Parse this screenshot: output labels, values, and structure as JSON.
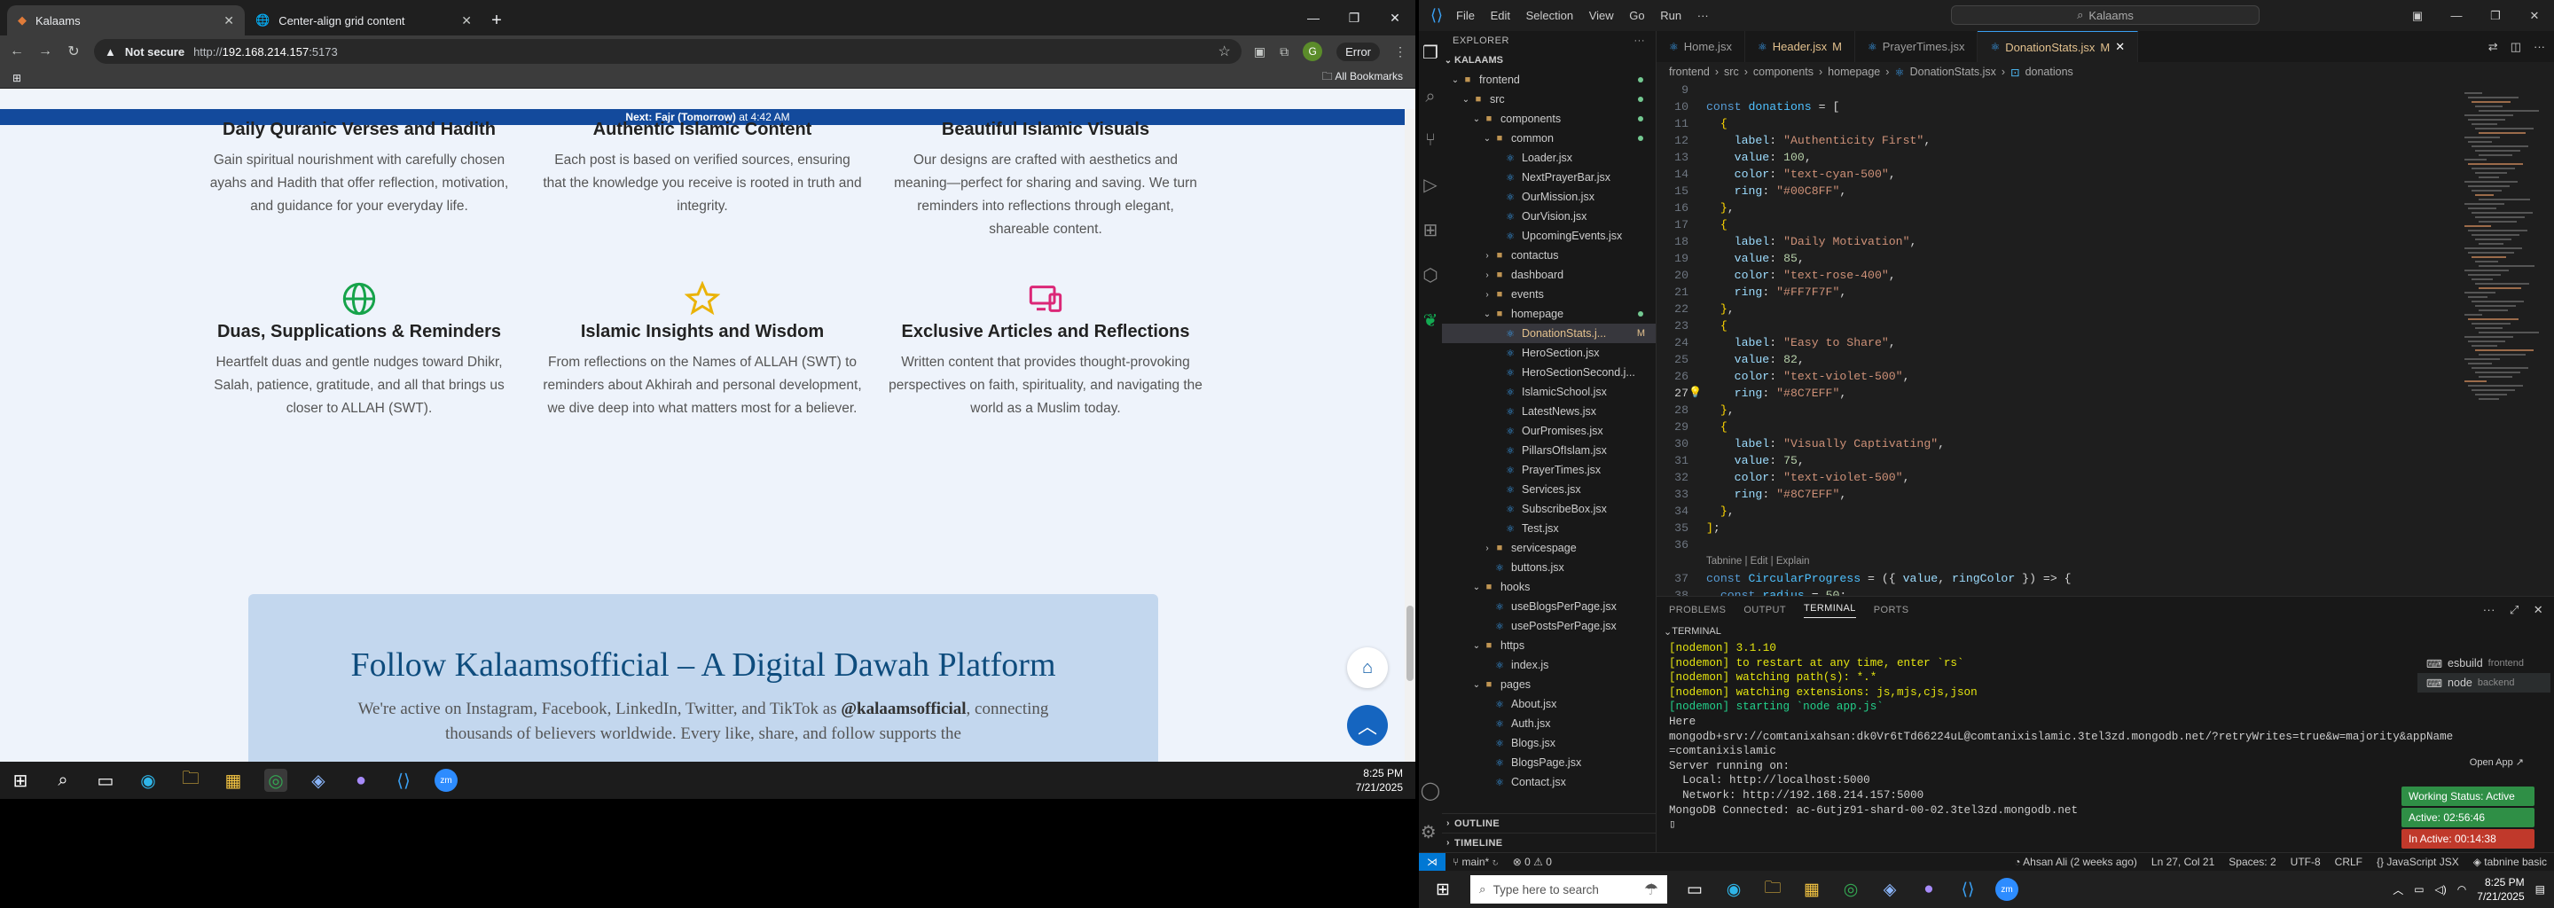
{
  "chrome": {
    "tabs": [
      {
        "title": "Kalaams",
        "icon": "kalaams-favicon",
        "active": true
      },
      {
        "title": "Center-align grid content",
        "icon": "globe-icon",
        "active": false
      }
    ],
    "address": {
      "not_secure": "Not secure",
      "url_prefix": "http://",
      "host": "192.168.214.157",
      "port": ":5173"
    },
    "profile_initial": "G",
    "error_label": "Error",
    "bookmarks_label": "All Bookmarks",
    "notice": {
      "label": "Next: Fajr (Tomorrow)",
      "time": "at 4:42 AM"
    },
    "features_top": [
      {
        "title": "Daily Quranic Verses and Hadith",
        "desc": "Gain spiritual nourishment with carefully chosen ayahs and Hadith that offer reflection, motivation, and guidance for your everyday life."
      },
      {
        "title": "Authentic Islamic Content",
        "desc": "Each post is based on verified sources, ensuring that the knowledge you receive is rooted in truth and integrity."
      },
      {
        "title": "Beautiful Islamic Visuals",
        "desc": "Our designs are crafted with aesthetics and meaning—perfect for sharing and saving. We turn reminders into reflections through elegant, shareable content."
      }
    ],
    "features_bottom": [
      {
        "title": "Duas, Supplications & Reminders",
        "desc": "Heartfelt duas and gentle nudges toward Dhikr, Salah, patience, gratitude, and all that brings us closer to ALLAH (SWT).",
        "icon": "globe-icon",
        "color": "#16a34a"
      },
      {
        "title": "Islamic Insights and Wisdom",
        "desc": "From reflections on the Names of ALLAH (SWT) to reminders about Akhirah and personal development, we dive deep into what matters most for a believer.",
        "icon": "star-icon",
        "color": "#eab308"
      },
      {
        "title": "Exclusive Articles and Reflections",
        "desc": "Written content that provides thought-provoking perspectives on faith, spirituality, and navigating the world as a Muslim today.",
        "icon": "devices-icon",
        "color": "#db2777"
      }
    ],
    "follow": {
      "title": "Follow Kalaamsofficial – A Digital Dawah Platform",
      "text_before": "We're active on Instagram, Facebook, LinkedIn, Twitter, and TikTok as ",
      "handle": "@kalaamsofficial",
      "text_after": ", connecting thousands of believers worldwide. Every like, share, and follow supports the"
    },
    "taskbar_clock": {
      "time": "8:25 PM",
      "date": "7/21/2025"
    }
  },
  "vscode": {
    "menu": [
      "File",
      "Edit",
      "Selection",
      "View",
      "Go",
      "Run",
      "···"
    ],
    "search": "Kalaams",
    "explorer_title": "EXPLORER",
    "root": "KALAAMS",
    "tree": [
      {
        "label": "frontend",
        "type": "folder",
        "depth": 0,
        "open": true,
        "dot": true
      },
      {
        "label": "src",
        "type": "folder",
        "depth": 1,
        "open": true,
        "dot": true
      },
      {
        "label": "components",
        "type": "folder",
        "depth": 2,
        "open": true,
        "dot": true
      },
      {
        "label": "common",
        "type": "folder",
        "depth": 3,
        "open": true,
        "dot": true
      },
      {
        "label": "Loader.jsx",
        "type": "jsx",
        "depth": 4
      },
      {
        "label": "NextPrayerBar.jsx",
        "type": "jsx",
        "depth": 4
      },
      {
        "label": "OurMission.jsx",
        "type": "jsx",
        "depth": 4
      },
      {
        "label": "OurVision.jsx",
        "type": "jsx",
        "depth": 4
      },
      {
        "label": "UpcomingEvents.jsx",
        "type": "jsx",
        "depth": 4
      },
      {
        "label": "contactus",
        "type": "folder",
        "depth": 3,
        "open": false
      },
      {
        "label": "dashboard",
        "type": "folder",
        "depth": 3,
        "open": false
      },
      {
        "label": "events",
        "type": "folder",
        "depth": 3,
        "open": false
      },
      {
        "label": "homepage",
        "type": "folder",
        "depth": 3,
        "open": true,
        "dot": true
      },
      {
        "label": "DonationStats.j...",
        "type": "jsx",
        "depth": 4,
        "selected": true,
        "badge": "M"
      },
      {
        "label": "HeroSection.jsx",
        "type": "jsx",
        "depth": 4
      },
      {
        "label": "HeroSectionSecond.j...",
        "type": "jsx",
        "depth": 4
      },
      {
        "label": "IslamicSchool.jsx",
        "type": "jsx",
        "depth": 4
      },
      {
        "label": "LatestNews.jsx",
        "type": "jsx",
        "depth": 4
      },
      {
        "label": "OurPromises.jsx",
        "type": "jsx",
        "depth": 4
      },
      {
        "label": "PillarsOfIslam.jsx",
        "type": "jsx",
        "depth": 4
      },
      {
        "label": "PrayerTimes.jsx",
        "type": "jsx",
        "depth": 4
      },
      {
        "label": "Services.jsx",
        "type": "jsx",
        "depth": 4
      },
      {
        "label": "SubscribeBox.jsx",
        "type": "jsx",
        "depth": 4
      },
      {
        "label": "Test.jsx",
        "type": "jsx",
        "depth": 4
      },
      {
        "label": "servicespage",
        "type": "folder",
        "depth": 3,
        "open": false
      },
      {
        "label": "buttons.jsx",
        "type": "jsx",
        "depth": 3
      },
      {
        "label": "hooks",
        "type": "folder",
        "depth": 2,
        "open": true
      },
      {
        "label": "useBlogsPerPage.jsx",
        "type": "jsx",
        "depth": 3
      },
      {
        "label": "usePostsPerPage.jsx",
        "type": "jsx",
        "depth": 3
      },
      {
        "label": "https",
        "type": "folder",
        "depth": 2,
        "open": true
      },
      {
        "label": "index.js",
        "type": "jsx",
        "depth": 3
      },
      {
        "label": "pages",
        "type": "folder",
        "depth": 2,
        "open": true
      },
      {
        "label": "About.jsx",
        "type": "jsx",
        "depth": 3
      },
      {
        "label": "Auth.jsx",
        "type": "jsx",
        "depth": 3
      },
      {
        "label": "Blogs.jsx",
        "type": "jsx",
        "depth": 3
      },
      {
        "label": "BlogsPage.jsx",
        "type": "jsx",
        "depth": 3
      },
      {
        "label": "Contact.jsx",
        "type": "jsx",
        "depth": 3
      }
    ],
    "side_footer": [
      "OUTLINE",
      "TIMELINE"
    ],
    "tabs": [
      {
        "label": "Home.jsx",
        "active": false,
        "mod": ""
      },
      {
        "label": "Header.jsx",
        "active": false,
        "mod": "M"
      },
      {
        "label": "PrayerTimes.jsx",
        "active": false,
        "mod": ""
      },
      {
        "label": "DonationStats.jsx",
        "active": true,
        "mod": "M"
      }
    ],
    "breadcrumb": [
      "frontend",
      "src",
      "components",
      "homepage",
      "DonationStats.jsx",
      "donations"
    ],
    "codelens": "Tabnine | Edit | Explain",
    "code_lines": [
      {
        "n": "9",
        "t": ""
      },
      {
        "n": "10",
        "t": "const donations = ["
      },
      {
        "n": "11",
        "t": "  {"
      },
      {
        "n": "12",
        "t": "    label: \"Authenticity First\","
      },
      {
        "n": "13",
        "t": "    value: 100,"
      },
      {
        "n": "14",
        "t": "    color: \"text-cyan-500\","
      },
      {
        "n": "15",
        "t": "    ring: \"#00C8FF\","
      },
      {
        "n": "16",
        "t": "  },"
      },
      {
        "n": "17",
        "t": "  {"
      },
      {
        "n": "18",
        "t": "    label: \"Daily Motivation\","
      },
      {
        "n": "19",
        "t": "    value: 85,"
      },
      {
        "n": "20",
        "t": "    color: \"text-rose-400\","
      },
      {
        "n": "21",
        "t": "    ring: \"#FF7F7F\","
      },
      {
        "n": "22",
        "t": "  },"
      },
      {
        "n": "23",
        "t": "  {"
      },
      {
        "n": "24",
        "t": "    label: \"Easy to Share\","
      },
      {
        "n": "25",
        "t": "    value: 82,"
      },
      {
        "n": "26",
        "t": "    color: \"text-violet-500\","
      },
      {
        "n": "27",
        "t": "    ring: \"#8C7EFF\","
      },
      {
        "n": "28",
        "t": "  },"
      },
      {
        "n": "29",
        "t": "  {"
      },
      {
        "n": "30",
        "t": "    label: \"Visually Captivating\","
      },
      {
        "n": "31",
        "t": "    value: 75,"
      },
      {
        "n": "32",
        "t": "    color: \"text-violet-500\","
      },
      {
        "n": "33",
        "t": "    ring: \"#8C7EFF\","
      },
      {
        "n": "34",
        "t": "  },"
      },
      {
        "n": "35",
        "t": "];"
      },
      {
        "n": "36",
        "t": ""
      },
      {
        "n": "37",
        "t": "const CircularProgress = ({ value, ringColor }) => {"
      },
      {
        "n": "38",
        "t": "  const radius = 50;"
      }
    ],
    "panel_tabs": [
      "PROBLEMS",
      "OUTPUT",
      "TERMINAL",
      "PORTS"
    ],
    "terminal_title": "TERMINAL",
    "terminal_lines": [
      {
        "c": "y",
        "t": "[nodemon] 3.1.10"
      },
      {
        "c": "y",
        "t": "[nodemon] to restart at any time, enter `rs`"
      },
      {
        "c": "y",
        "t": "[nodemon] watching path(s): *.*"
      },
      {
        "c": "y",
        "t": "[nodemon] watching extensions: js,mjs,cjs,json"
      },
      {
        "c": "g",
        "t": "[nodemon] starting `node app.js`"
      },
      {
        "c": "",
        "t": "Here"
      },
      {
        "c": "",
        "t": "mongodb+srv://comtanixahsan:dk0Vr6tTd66224uL@comtanixislamic.3tel3zd.mongodb.net/?retryWrites=true&w=majority&appName"
      },
      {
        "c": "",
        "t": "=comtanixislamic"
      },
      {
        "c": "",
        "t": "Server running on:"
      },
      {
        "c": "",
        "t": "  Local: http://localhost:5000"
      },
      {
        "c": "",
        "t": "  Network: http://192.168.214.157:5000"
      },
      {
        "c": "",
        "t": "MongoDB Connected: ac-6utjz91-shard-00-02.3tel3zd.mongodb.net"
      }
    ],
    "terminal_list": [
      {
        "name": "esbuild",
        "sub": "frontend"
      },
      {
        "name": "node",
        "sub": "backend"
      }
    ],
    "open_app": "Open App ↗",
    "working_status": "Working Status: Active",
    "active_time": "Active: 02:56:46",
    "inactive_time": "In Active: 00:14:38",
    "status": {
      "branch": "main*",
      "problems": "⊗ 0 ⚠ 0",
      "blame": "Ahsan Ali (2 weeks ago)",
      "position": "Ln 27, Col 21",
      "spaces": "Spaces: 2",
      "encoding": "UTF-8",
      "eol": "CRLF",
      "lang": "{} JavaScript JSX",
      "tabnine": "tabnine basic"
    },
    "taskbar": {
      "search_placeholder": "Type here to search",
      "time": "8:25 PM",
      "date": "7/21/2025"
    }
  }
}
